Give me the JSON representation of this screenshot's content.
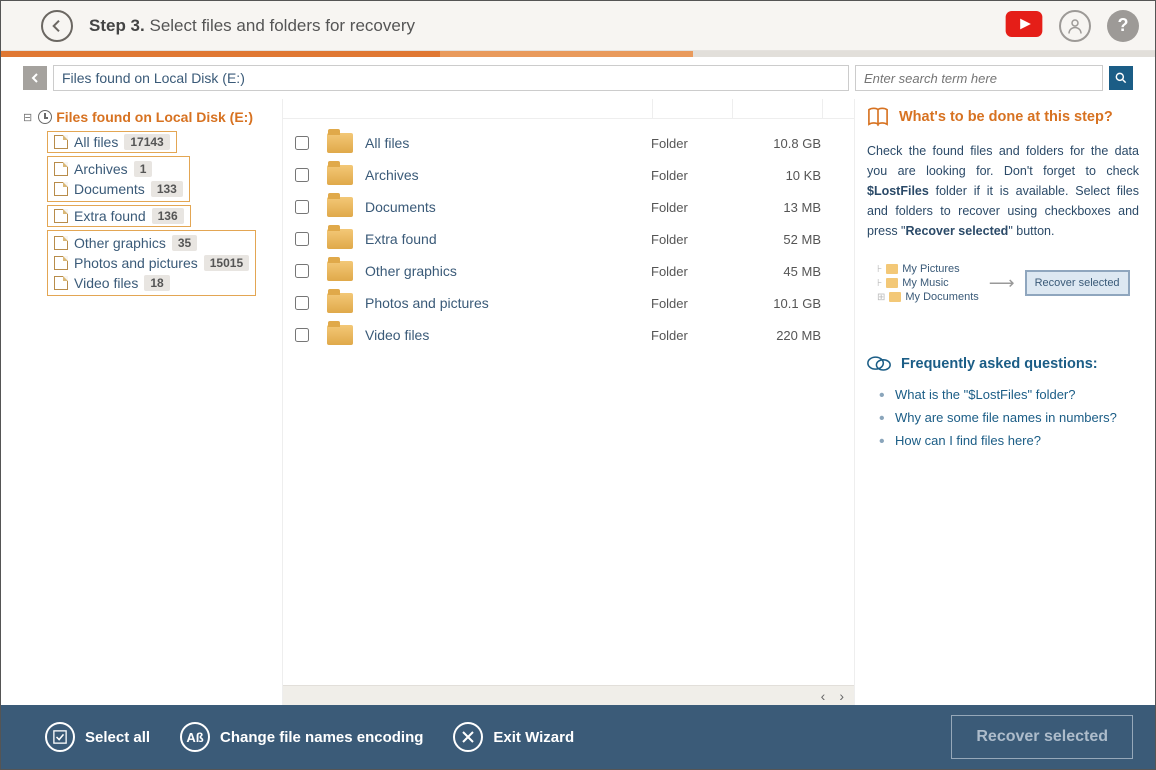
{
  "header": {
    "step_label": "Step 3.",
    "step_text": "Select files and folders for recovery"
  },
  "breadcrumb": "Files found on Local Disk (E:)",
  "search_placeholder": "Enter search term here",
  "tree": {
    "root": "Files found on Local Disk (E:)",
    "items": [
      {
        "label": "All files",
        "count": "17143"
      },
      {
        "label": "Archives",
        "count": "1"
      },
      {
        "label": "Documents",
        "count": "133"
      },
      {
        "label": "Extra found",
        "count": "136"
      },
      {
        "label": "Other graphics",
        "count": "35"
      },
      {
        "label": "Photos and pictures",
        "count": "15015"
      },
      {
        "label": "Video files",
        "count": "18"
      }
    ]
  },
  "list": {
    "rows": [
      {
        "name": "All files",
        "type": "Folder",
        "size": "10.8 GB"
      },
      {
        "name": "Archives",
        "type": "Folder",
        "size": "10 KB"
      },
      {
        "name": "Documents",
        "type": "Folder",
        "size": "13 MB"
      },
      {
        "name": "Extra found",
        "type": "Folder",
        "size": "52 MB"
      },
      {
        "name": "Other graphics",
        "type": "Folder",
        "size": "45 MB"
      },
      {
        "name": "Photos and pictures",
        "type": "Folder",
        "size": "10.1 GB"
      },
      {
        "name": "Video files",
        "type": "Folder",
        "size": "220 MB"
      }
    ]
  },
  "help": {
    "title": "What's to be done at this step?",
    "body_pre": "Check the found files and folders for the data you are looking for. Don't forget to check ",
    "body_bold1": "$LostFiles",
    "body_mid": " folder if it is available. Select files and folders to recover using checkboxes and press \"",
    "body_bold2": "Recover selected",
    "body_post": "\" button.",
    "illus": {
      "r1": "My Pictures",
      "r2": "My Music",
      "r3": "My Documents",
      "btn": "Recover selected"
    },
    "faq_title": "Frequently asked questions:",
    "faq": [
      "What is the \"$LostFiles\" folder?",
      "Why are some file names in numbers?",
      "How can I find files here?"
    ]
  },
  "bottom": {
    "select_all": "Select all",
    "encoding": "Change file names encoding",
    "exit": "Exit Wizard",
    "recover": "Recover selected"
  }
}
